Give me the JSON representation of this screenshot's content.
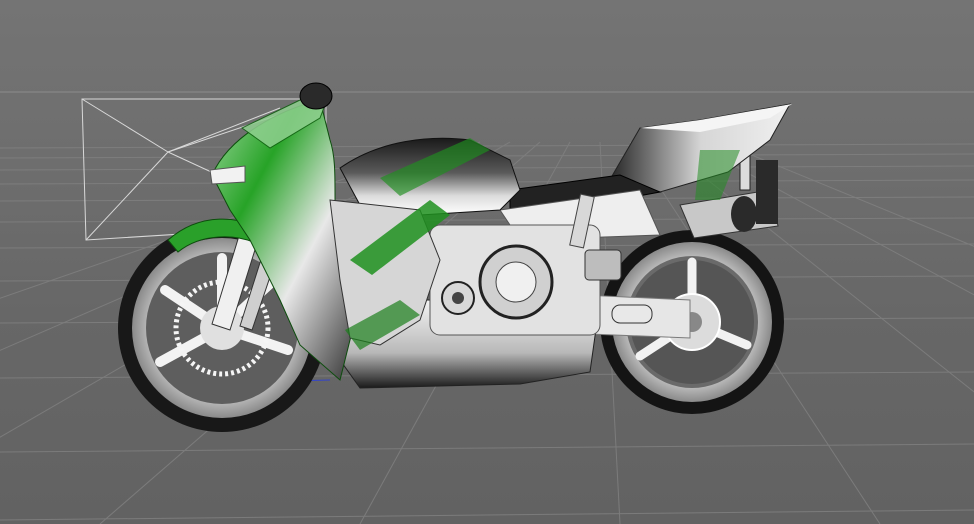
{
  "viewport": {
    "background_color": "#6b6b6b",
    "grid_color": "#7f7f7f",
    "horizon_line_color": "#8a8a8a"
  },
  "scene": {
    "object": "motorcycle",
    "body_colors": {
      "fairing_green": "#1e9a1e",
      "fairing_dark_green": "#0d5e12",
      "shaded_white": "#e6e6e6",
      "shadow_black": "#101010"
    },
    "wireframe_color": "#d8d8d8",
    "axis_line_color": "#3344cc"
  }
}
